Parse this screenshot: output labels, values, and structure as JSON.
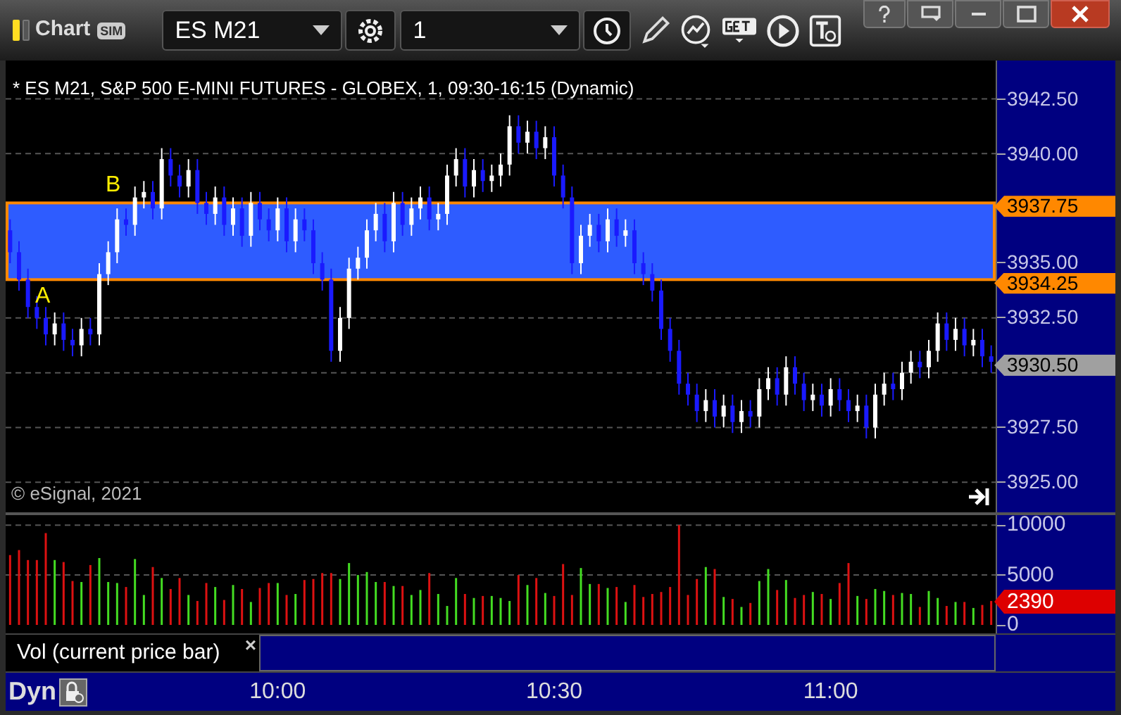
{
  "title_bar": {
    "title": "Chart",
    "badge": "SIM",
    "symbol": "ES M21",
    "interval": "1"
  },
  "price_pane": {
    "caption": "* ES M21, S&P 500 E-MINI FUTURES - GLOBEX, 1, 09:30-16:15 (Dynamic)",
    "copyright": "© eSignal, 2021",
    "zone_labels": [
      "B",
      "A"
    ],
    "markers": [
      {
        "label": "3937.75",
        "kind": "zone"
      },
      {
        "label": "3934.25",
        "kind": "zone"
      },
      {
        "label": "3930.50",
        "kind": "last"
      }
    ],
    "chart_data": {
      "type": "candlestick",
      "grid": true,
      "ylim": [
        3923.5,
        3944.25
      ],
      "yticks": [
        {
          "value": 3942.5,
          "label": "3942.50"
        },
        {
          "value": 3940,
          "label": "3940.00"
        },
        {
          "value": 3935,
          "label": "3935.00"
        },
        {
          "value": 3932.5,
          "label": "3932.50"
        },
        {
          "value": 3927.5,
          "label": "3927.50"
        },
        {
          "value": 3925,
          "label": "3925.00"
        }
      ],
      "ohlc": [
        [
          3936.5,
          3937,
          3935,
          3935.5
        ],
        [
          3935.5,
          3936,
          3933.75,
          3934.25
        ],
        [
          3934.25,
          3934.75,
          3932.5,
          3933
        ],
        [
          3933,
          3933.5,
          3932,
          3932.5
        ],
        [
          3932.5,
          3933,
          3931.25,
          3931.75
        ],
        [
          3931.75,
          3932.75,
          3931.25,
          3932.25
        ],
        [
          3932.25,
          3932.75,
          3931,
          3931.5
        ],
        [
          3931.5,
          3932,
          3930.75,
          3931.25
        ],
        [
          3931.25,
          3932.5,
          3930.75,
          3932
        ],
        [
          3932,
          3932.5,
          3931.25,
          3931.75
        ],
        [
          3931.75,
          3935,
          3931.25,
          3934.5
        ],
        [
          3934.5,
          3936,
          3934,
          3935.5
        ],
        [
          3935.5,
          3937.5,
          3935,
          3937
        ],
        [
          3937,
          3937.5,
          3936.25,
          3936.75
        ],
        [
          3936.75,
          3938.5,
          3936.25,
          3938
        ],
        [
          3938,
          3938.75,
          3937.5,
          3938.25
        ],
        [
          3938.25,
          3938.75,
          3937,
          3937.5
        ],
        [
          3937.5,
          3940.25,
          3937,
          3939.75
        ],
        [
          3939.75,
          3940.25,
          3938.5,
          3939
        ],
        [
          3939,
          3939.5,
          3938,
          3938.5
        ],
        [
          3938.5,
          3939.75,
          3938,
          3939.25
        ],
        [
          3939.25,
          3939.75,
          3937.25,
          3937.75
        ],
        [
          3937.75,
          3938.25,
          3936.75,
          3937.25
        ],
        [
          3937.25,
          3938.5,
          3936.75,
          3938
        ],
        [
          3938,
          3938.5,
          3936.25,
          3936.75
        ],
        [
          3936.75,
          3938,
          3936.25,
          3937.5
        ],
        [
          3937.5,
          3938,
          3935.75,
          3936.25
        ],
        [
          3936.25,
          3938.25,
          3935.75,
          3937.75
        ],
        [
          3937.75,
          3938.25,
          3936.5,
          3937
        ],
        [
          3937,
          3937.5,
          3936,
          3936.5
        ],
        [
          3936.5,
          3938,
          3936,
          3937.5
        ],
        [
          3937.5,
          3938,
          3935.5,
          3936
        ],
        [
          3936,
          3937.5,
          3935.5,
          3937
        ],
        [
          3937,
          3937.5,
          3936,
          3936.5
        ],
        [
          3936.5,
          3937,
          3934.5,
          3935
        ],
        [
          3935,
          3935.5,
          3933.75,
          3934.25
        ],
        [
          3934.25,
          3934.75,
          3930.5,
          3931
        ],
        [
          3931,
          3933,
          3930.5,
          3932.5
        ],
        [
          3932.5,
          3935.25,
          3932,
          3934.75
        ],
        [
          3934.75,
          3935.75,
          3934.25,
          3935.25
        ],
        [
          3935.25,
          3937,
          3934.75,
          3936.5
        ],
        [
          3936.5,
          3937.75,
          3936,
          3937.25
        ],
        [
          3937.25,
          3937.75,
          3935.5,
          3936
        ],
        [
          3936,
          3938.25,
          3935.5,
          3937.75
        ],
        [
          3937.75,
          3938.25,
          3936.25,
          3936.75
        ],
        [
          3936.75,
          3938,
          3936.25,
          3937.5
        ],
        [
          3937.5,
          3938.5,
          3937,
          3938
        ],
        [
          3938,
          3938.5,
          3936.5,
          3937
        ],
        [
          3937,
          3937.75,
          3936.5,
          3937.25
        ],
        [
          3937.25,
          3939.5,
          3936.75,
          3939
        ],
        [
          3939,
          3940.25,
          3938.5,
          3939.75
        ],
        [
          3939.75,
          3940.25,
          3938,
          3938.5
        ],
        [
          3938.5,
          3939.75,
          3938,
          3939.25
        ],
        [
          3939.25,
          3939.75,
          3938.25,
          3938.75
        ],
        [
          3938.75,
          3939.5,
          3938.25,
          3939
        ],
        [
          3939,
          3940,
          3938.5,
          3939.5
        ],
        [
          3939.5,
          3941.75,
          3939,
          3941.25
        ],
        [
          3941.25,
          3941.75,
          3940,
          3940.5
        ],
        [
          3940.5,
          3941.5,
          3940,
          3941
        ],
        [
          3941,
          3941.5,
          3939.75,
          3940.25
        ],
        [
          3940.25,
          3941.25,
          3939.75,
          3940.75
        ],
        [
          3940.75,
          3941.25,
          3938.5,
          3939
        ],
        [
          3939,
          3939.5,
          3937.5,
          3938
        ],
        [
          3938,
          3938.5,
          3934.5,
          3935
        ],
        [
          3935,
          3936.75,
          3934.5,
          3936.25
        ],
        [
          3936.25,
          3937.25,
          3935.75,
          3936.75
        ],
        [
          3936.75,
          3937.25,
          3935.5,
          3936
        ],
        [
          3936,
          3937.5,
          3935.5,
          3937
        ],
        [
          3937,
          3937.5,
          3935.75,
          3936.25
        ],
        [
          3936.25,
          3937,
          3935.75,
          3936.5
        ],
        [
          3936.5,
          3937,
          3934.5,
          3935
        ],
        [
          3935,
          3935.5,
          3934,
          3934.5
        ],
        [
          3934.5,
          3935,
          3933.25,
          3933.75
        ],
        [
          3933.75,
          3934.25,
          3931.5,
          3932
        ],
        [
          3932,
          3932.5,
          3930.5,
          3931
        ],
        [
          3931,
          3931.5,
          3929,
          3929.5
        ],
        [
          3929.5,
          3930,
          3928.5,
          3929
        ],
        [
          3929,
          3929.5,
          3927.75,
          3928.25
        ],
        [
          3928.25,
          3929.25,
          3927.75,
          3928.75
        ],
        [
          3928.75,
          3929.25,
          3927.5,
          3928
        ],
        [
          3928,
          3929,
          3927.5,
          3928.5
        ],
        [
          3928.5,
          3929,
          3927.25,
          3927.75
        ],
        [
          3927.75,
          3928.75,
          3927.25,
          3928.25
        ],
        [
          3928.25,
          3928.75,
          3927.5,
          3928
        ],
        [
          3928,
          3929.75,
          3927.5,
          3929.25
        ],
        [
          3929.25,
          3930.25,
          3928.75,
          3929.75
        ],
        [
          3929.75,
          3930.25,
          3928.5,
          3929
        ],
        [
          3929,
          3930.75,
          3928.5,
          3930.25
        ],
        [
          3930.25,
          3930.75,
          3929,
          3929.5
        ],
        [
          3929.5,
          3930,
          3928.25,
          3928.75
        ],
        [
          3928.75,
          3929.5,
          3928.25,
          3929
        ],
        [
          3929,
          3929.5,
          3928,
          3928.5
        ],
        [
          3928.5,
          3929.75,
          3928,
          3929.25
        ],
        [
          3929.25,
          3929.75,
          3928.25,
          3928.75
        ],
        [
          3928.75,
          3929.25,
          3927.75,
          3928.25
        ],
        [
          3928.25,
          3929,
          3927.75,
          3928.5
        ],
        [
          3928.5,
          3929,
          3927,
          3927.5
        ],
        [
          3927.5,
          3929.5,
          3927,
          3929
        ],
        [
          3929,
          3930,
          3928.5,
          3929.5
        ],
        [
          3929.5,
          3930,
          3928.75,
          3929.25
        ],
        [
          3929.25,
          3930.5,
          3928.75,
          3930
        ],
        [
          3930,
          3931,
          3929.5,
          3930.5
        ],
        [
          3930.5,
          3931,
          3929.75,
          3930.25
        ],
        [
          3930.25,
          3931.5,
          3929.75,
          3931
        ],
        [
          3931,
          3932.75,
          3930.5,
          3932.25
        ],
        [
          3932.25,
          3932.75,
          3931,
          3931.5
        ],
        [
          3931.5,
          3932.5,
          3931,
          3932
        ],
        [
          3932,
          3932.5,
          3930.75,
          3931.25
        ],
        [
          3931.25,
          3932,
          3930.75,
          3931.5
        ],
        [
          3931.5,
          3932,
          3930.25,
          3930.75
        ],
        [
          3930.75,
          3931.25,
          3930,
          3930.5
        ]
      ]
    }
  },
  "volume_pane": {
    "legend": "Vol (current price bar)",
    "close": "×",
    "current_value": "2390",
    "chart_data": {
      "type": "bar",
      "grid": true,
      "ylim": [
        0,
        11000
      ],
      "yticks": [
        {
          "value": 10000,
          "label": "10000"
        },
        {
          "value": 5000,
          "label": "5000"
        },
        {
          "value": 0,
          "label": "0"
        }
      ],
      "series": [
        {
          "values": [
            7000,
            7500,
            6500,
            6500,
            9200,
            6500,
            6300,
            4400,
            4300,
            6000,
            6700,
            4300,
            4200,
            3800,
            6600,
            3000,
            5800,
            4700,
            3600,
            4700,
            3000,
            2400,
            4200,
            3800,
            2500,
            4000,
            3600,
            2300,
            3700,
            4200,
            4200,
            3000,
            3100,
            4500,
            4600,
            5200,
            5200,
            4600,
            6200,
            5000,
            5300,
            4300,
            4300,
            3900,
            3900,
            3000,
            3500,
            5200,
            3100,
            1900,
            4700,
            3100,
            2700,
            2900,
            2900,
            2700,
            2400,
            5000,
            4000,
            4700,
            3200,
            2900,
            6100,
            3000,
            5700,
            4100,
            4100,
            3700,
            3800,
            2300,
            4000,
            2800,
            3100,
            3300,
            3800,
            10000,
            3000,
            4600,
            5800,
            5600,
            2800,
            2600,
            1800,
            2200,
            4400,
            5600,
            3500,
            4500,
            2700,
            3000,
            3300,
            3100,
            2600,
            4200,
            6200,
            2900,
            2600,
            3600,
            3400,
            3000,
            3200,
            3100,
            1800,
            3400,
            2700,
            1900,
            2300,
            2300,
            1700,
            2000,
            2400
          ]
        }
      ]
    }
  },
  "time_axis": [
    "10:00",
    "10:30",
    "11:00"
  ],
  "footer": {
    "label": "Dyn"
  }
}
